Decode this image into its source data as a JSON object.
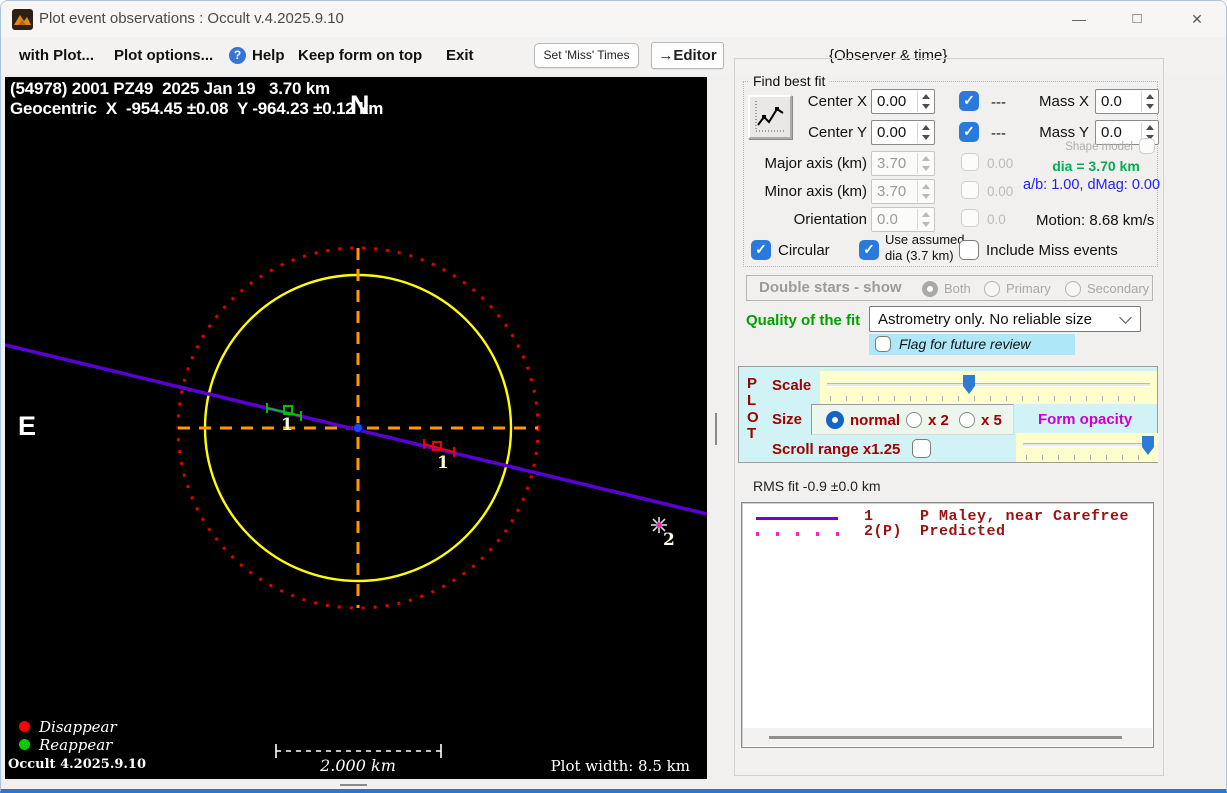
{
  "window": {
    "title": "Plot event observations : Occult v.4.2025.9.10"
  },
  "icons": {
    "minimize": "—",
    "maximize": "□",
    "close": "✕",
    "help": "?",
    "check": "✓"
  },
  "menu": {
    "with_plot": "with Plot...",
    "plot_options": "Plot options...",
    "help": "Help",
    "keep_on_top": "Keep form on top",
    "exit": "Exit",
    "set_miss_times": "Set 'Miss' Times",
    "editor": "→Editor",
    "observer_time": "{Observer & time}"
  },
  "plot": {
    "title_line1": "(54978) 2001 PZ49  2025 Jan 19   3.70 km",
    "title_line2": "Geocentric  X  -954.45 ±0.08  Y -964.23 ±0.12 km",
    "north": "N",
    "east": "E",
    "marker1_green": "1",
    "marker1_red": "1",
    "marker2": "2",
    "legend_disappear": "Disappear",
    "legend_reappear": "Reappear",
    "version": "Occult 4.2025.9.10",
    "scale_bar_label": "2.000 km",
    "plot_width_label": "Plot width: 8.5 km",
    "colors": {
      "asteroid_circle": "#ffff00",
      "uncertainty_circle": "#e00000",
      "crosshair": "#ff9900",
      "chord": "#5a00d4",
      "disappear": "#ff0000",
      "reappear": "#00cc00",
      "predicted": "#ff22aa"
    }
  },
  "fit": {
    "group_title": "Find best fit",
    "center_x_label": "Center X",
    "center_x_value": "0.00",
    "dash_x": "---",
    "center_y_label": "Center Y",
    "center_y_value": "0.00",
    "dash_y": "---",
    "mass_x_label": "Mass X",
    "mass_x_value": "0.0",
    "mass_y_label": "Mass Y",
    "mass_y_value": "0.0",
    "shape_model_label": "Shape model",
    "major_label": "Major axis (km)",
    "major_value": "3.70",
    "major_check": "0.00",
    "minor_label": "Minor axis (km)",
    "minor_value": "3.70",
    "minor_check": "0.00",
    "orientation_label": "Orientation",
    "orientation_value": "0.0",
    "orientation_check": "0.0",
    "dia_text": "dia = 3.70 km",
    "ab_text": "a/b: 1.00, dMag: 0.00",
    "motion_text": "Motion: 8.68 km/s",
    "circular_label": "Circular",
    "use_assumed_label": "Use assumed\ndia (3.7 km)",
    "include_miss_label": "Include Miss events"
  },
  "double_stars": {
    "title": "Double stars - show",
    "both": "Both",
    "primary": "Primary",
    "secondary": "Secondary"
  },
  "quality": {
    "label": "Quality of the fit",
    "value": "Astrometry only. No reliable size",
    "flag_label": "Flag for future review"
  },
  "plot_panel": {
    "vertical": "P\nL\nO\nT",
    "scale_label": "Scale",
    "size_label": "Size",
    "size_normal": "normal",
    "size_x2": "x 2",
    "size_x5": "x 5",
    "form_opacity": "Form opacity",
    "scroll_range": "Scroll range x1.25"
  },
  "rms": {
    "label": "RMS fit -0.9 ±0.0 km",
    "rows": [
      {
        "num": "1",
        "desc": "P Maley, near Carefree",
        "style": "solid-purple"
      },
      {
        "num": "2(P)",
        "desc": "Predicted",
        "style": "dotted-magenta"
      }
    ]
  }
}
